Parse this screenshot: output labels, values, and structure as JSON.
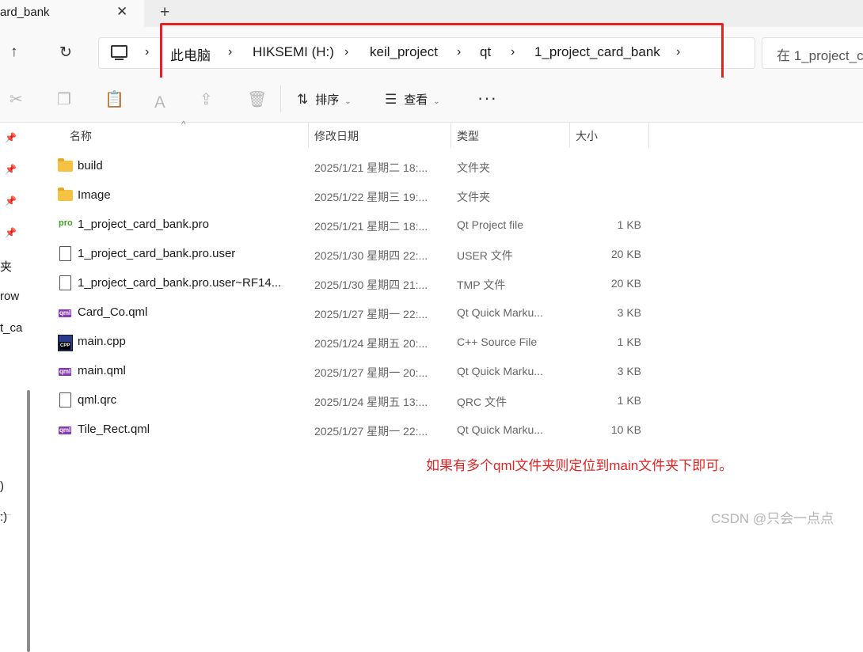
{
  "window": {
    "tab_title": "ard_bank",
    "tab_close": "✕",
    "new_tab": "+"
  },
  "address_bar": {
    "up_icon": "↑",
    "refresh_icon": "↻",
    "crumbs": [
      "此电脑",
      "HIKSEMI (H:)",
      "keil_project",
      "qt",
      "1_project_card_bank"
    ],
    "separator": "›",
    "search_placeholder": "在 1_project_c"
  },
  "toolbar": {
    "sort_label": "排序",
    "view_label": "查看",
    "more_label": "···",
    "sort_icon": "⇅",
    "view_icon": "☰",
    "chevron": "⌄",
    "icons": [
      "cut-icon",
      "copy-icon",
      "paste-icon",
      "rename-icon",
      "share-icon",
      "delete-icon"
    ]
  },
  "left_pane": {
    "fragments": [
      "夹",
      "row",
      "t_ca",
      "(",
      ")",
      ":)"
    ]
  },
  "columns": {
    "name": "名称",
    "date": "修改日期",
    "type": "类型",
    "size": "大小",
    "sort_indicator": "^"
  },
  "files": [
    {
      "name": "build",
      "date": "2025/1/21 星期二 18:...",
      "type": "文件夹",
      "size": "",
      "icon": "folder"
    },
    {
      "name": "Image",
      "date": "2025/1/22 星期三 19:...",
      "type": "文件夹",
      "size": "",
      "icon": "folder"
    },
    {
      "name": "1_project_card_bank.pro",
      "date": "2025/1/21 星期二 18:...",
      "type": "Qt Project file",
      "size": "1 KB",
      "icon": "pro"
    },
    {
      "name": "1_project_card_bank.pro.user",
      "date": "2025/1/30 星期四 22:...",
      "type": "USER 文件",
      "size": "20 KB",
      "icon": "doc"
    },
    {
      "name": "1_project_card_bank.pro.user~RF14...",
      "date": "2025/1/30 星期四 21:...",
      "type": "TMP 文件",
      "size": "20 KB",
      "icon": "doc"
    },
    {
      "name": "Card_Co.qml",
      "date": "2025/1/27 星期一 22:...",
      "type": "Qt Quick Marku...",
      "size": "3 KB",
      "icon": "qml"
    },
    {
      "name": "main.cpp",
      "date": "2025/1/24 星期五 20:...",
      "type": "C++ Source File",
      "size": "1 KB",
      "icon": "cpp"
    },
    {
      "name": "main.qml",
      "date": "2025/1/27 星期一 20:...",
      "type": "Qt Quick Marku...",
      "size": "3 KB",
      "icon": "qml"
    },
    {
      "name": "qml.qrc",
      "date": "2025/1/24 星期五 13:...",
      "type": "QRC 文件",
      "size": "1 KB",
      "icon": "doc"
    },
    {
      "name": "Tile_Rect.qml",
      "date": "2025/1/27 星期一 22:...",
      "type": "Qt Quick Marku...",
      "size": "10 KB",
      "icon": "qml"
    }
  ],
  "annotation": {
    "note": "如果有多个qml文件夹则定位到main文件夹下即可。",
    "highlight_color": "#e02424"
  },
  "watermark": "CSDN @只会一点点"
}
